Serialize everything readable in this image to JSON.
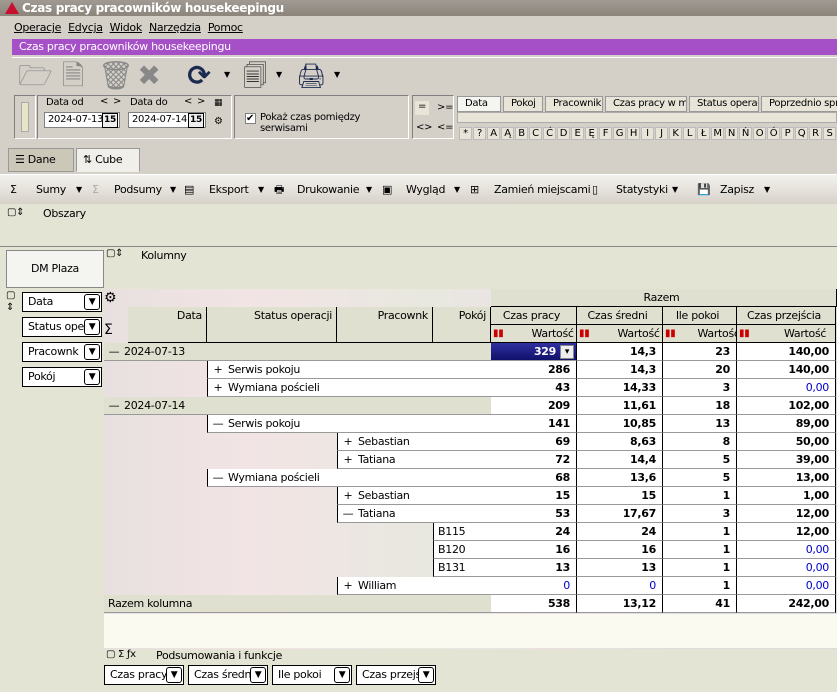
{
  "window": {
    "title": "Czas pracy pracowników housekeepingu"
  },
  "menu": [
    "Operacje",
    "Edycja",
    "Widok",
    "Narzędzia",
    "Pomoc"
  ],
  "banner": "Czas pracy pracowników housekeepingu",
  "filters": {
    "date_from_label": "Data od",
    "date_from": "2024-07-13",
    "date_to_label": "Data do",
    "date_to": "2024-07-14",
    "show_between_label": "Pokaż czas pomiędzy serwisami",
    "show_between_checked": true,
    "ops": [
      "=",
      ">=",
      "<>",
      "<="
    ],
    "nav_prev": "<",
    "nav_next": ">",
    "cal": "15"
  },
  "search_tabs": [
    "Data",
    "Pokoj",
    "Pracownik",
    "Czas pracy w min.",
    "Status operacji",
    "Poprzednio sprząt"
  ],
  "letters": [
    "*",
    "?",
    "A",
    "Ą",
    "B",
    "C",
    "Ć",
    "D",
    "E",
    "Ę",
    "F",
    "G",
    "H",
    "I",
    "J",
    "K",
    "L",
    "Ł",
    "M",
    "N",
    "Ń",
    "O",
    "Ó",
    "P",
    "Q",
    "R",
    "S"
  ],
  "view_tabs": [
    "Dane",
    "Cube"
  ],
  "toolbar2": [
    "Sumy",
    "Podsumy",
    "Eksport",
    "Drukowanie",
    "Wygląd",
    "Zamień miejscami",
    "Statystyki",
    "Zapisz"
  ],
  "areas_label": "Obszary",
  "hotel": "DM Plaza",
  "columns_label": "Kolumny",
  "row_fields": [
    "Data",
    "Status oper",
    "Pracownk",
    "Pokój"
  ],
  "row_headers": [
    "Data",
    "Status operacji",
    "Pracownk",
    "Pokój"
  ],
  "col_group": "Razem",
  "measures": [
    "Czas pracy",
    "Czas średni",
    "Ile pokoi",
    "Czas przejścia"
  ],
  "measure_sub": "Wartość",
  "rows": [
    {
      "level": 0,
      "toggle": "—",
      "label": "2024-07-13",
      "values": [
        "329",
        "14,3",
        "23",
        "140,00"
      ]
    },
    {
      "level": 1,
      "toggle": "+",
      "label": "Serwis pokoju",
      "values": [
        "286",
        "14,3",
        "20",
        "140,00"
      ]
    },
    {
      "level": 1,
      "toggle": "+",
      "label": "Wymiana pościeli",
      "values": [
        "43",
        "14,33",
        "3",
        "0,00"
      ]
    },
    {
      "level": 0,
      "toggle": "—",
      "label": "2024-07-14",
      "values": [
        "209",
        "11,61",
        "18",
        "102,00"
      ]
    },
    {
      "level": 1,
      "toggle": "—",
      "label": "Serwis pokoju",
      "values": [
        "141",
        "10,85",
        "13",
        "89,00"
      ]
    },
    {
      "level": 2,
      "toggle": "+",
      "label": "Sebastian",
      "values": [
        "69",
        "8,63",
        "8",
        "50,00"
      ]
    },
    {
      "level": 2,
      "toggle": "+",
      "label": "Tatiana",
      "values": [
        "72",
        "14,4",
        "5",
        "39,00"
      ]
    },
    {
      "level": 1,
      "toggle": "—",
      "label": "Wymiana pościeli",
      "values": [
        "68",
        "13,6",
        "5",
        "13,00"
      ]
    },
    {
      "level": 2,
      "toggle": "+",
      "label": "Sebastian",
      "values": [
        "15",
        "15",
        "1",
        "1,00"
      ]
    },
    {
      "level": 2,
      "toggle": "—",
      "label": "Tatiana",
      "values": [
        "53",
        "17,67",
        "3",
        "12,00"
      ]
    },
    {
      "level": 3,
      "toggle": "",
      "label": "B115",
      "values": [
        "24",
        "24",
        "1",
        "12,00"
      ]
    },
    {
      "level": 3,
      "toggle": "",
      "label": "B120",
      "values": [
        "16",
        "16",
        "1",
        "0,00"
      ]
    },
    {
      "level": 3,
      "toggle": "",
      "label": "B131",
      "values": [
        "13",
        "13",
        "1",
        "0,00"
      ]
    },
    {
      "level": 2,
      "toggle": "+",
      "label": "William",
      "values": [
        "0",
        "0",
        "1",
        "0,00"
      ]
    }
  ],
  "total": {
    "label": "Razem kolumna",
    "values": [
      "538",
      "13,12",
      "41",
      "242,00"
    ]
  },
  "summary_label": "Podsumowania i funkcje",
  "summary_fields": [
    "Czas pracy",
    "Czas średni",
    "Ile pokoi",
    "Czas przejś"
  ],
  "colors": {
    "accent": "#a650c8",
    "selected_cell": "#1a1a8c",
    "zero_value": "#0000cc"
  }
}
